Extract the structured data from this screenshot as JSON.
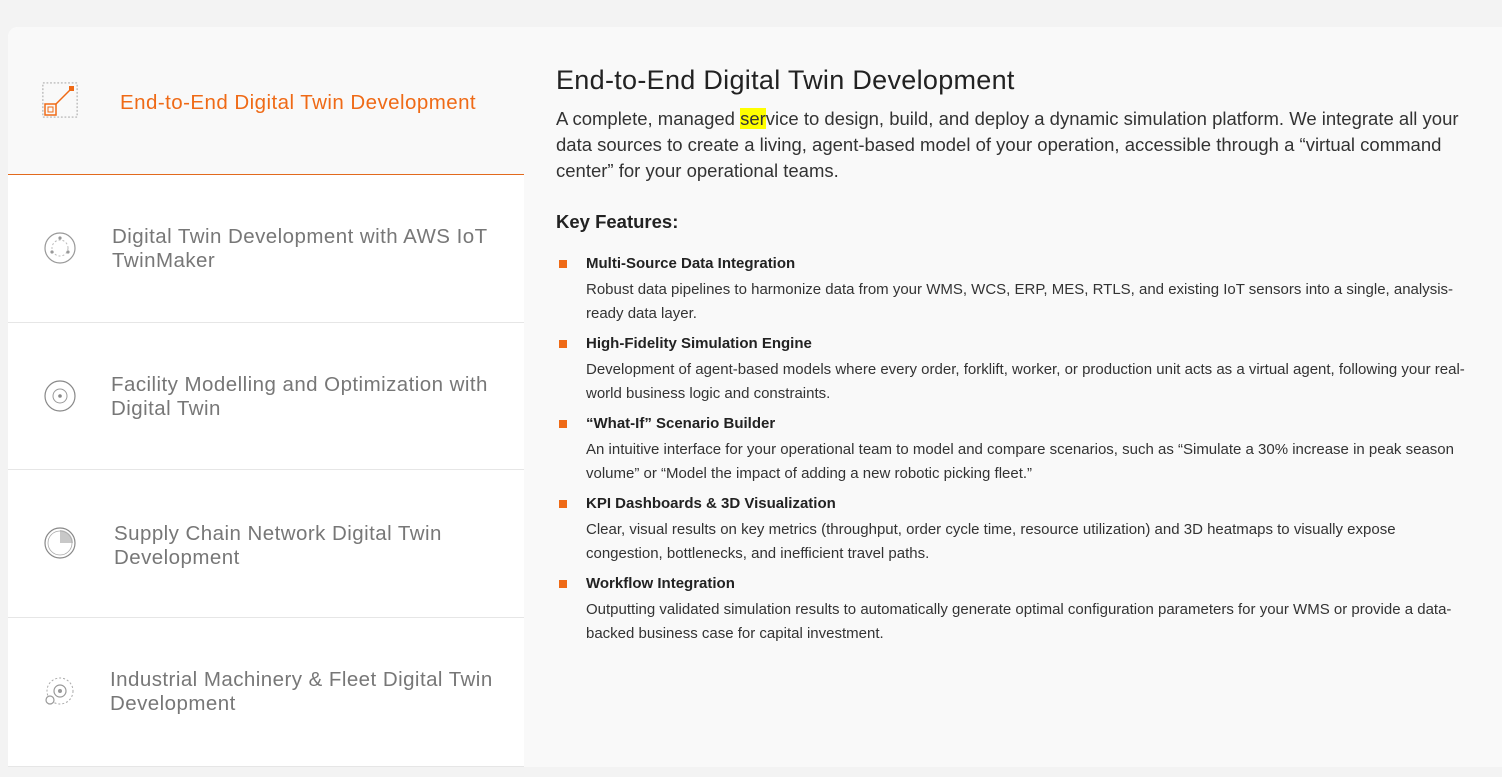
{
  "tabs": [
    {
      "label": "End-to-End Digital Twin Development",
      "icon": "diagonal-arrow-square-icon"
    },
    {
      "label": "Digital Twin Development with AWS IoT TwinMaker",
      "icon": "dotted-circle-icon"
    },
    {
      "label": "Facility Modelling and Optimization with Digital Twin",
      "icon": "target-circle-icon"
    },
    {
      "label": "Supply Chain Network Digital Twin Development",
      "icon": "quarter-pie-icon"
    },
    {
      "label": "Industrial Machinery & Fleet Digital Twin Development",
      "icon": "gear-circles-icon"
    }
  ],
  "content": {
    "title": "End-to-End Digital Twin Development",
    "description_before": "A complete, managed ",
    "description_highlight": "ser",
    "description_after": "vice to design, build, and deploy a dynamic simulation platform. We integrate all your data sources to create a living, agent-based model of your operation, accessible through a “virtual command center” for your operational teams.",
    "features_heading": "Key Features:",
    "features": [
      {
        "title": "Multi-Source Data Integration",
        "desc": "Robust data pipelines to harmonize data from your WMS, WCS, ERP, MES, RTLS, and existing IoT sensors into a single, analysis-ready data layer."
      },
      {
        "title": "High-Fidelity Simulation Engine",
        "desc": "Development of agent-based models where every order, forklift, worker, or production unit acts as a virtual agent, following your real-world business logic and constraints."
      },
      {
        "title": "“What-If” Scenario Builder",
        "desc": "An intuitive interface for your operational team to model and compare scenarios, such as “Simulate a 30% increase in peak season volume” or “Model the impact of adding a new robotic picking fleet.”"
      },
      {
        "title": "KPI Dashboards & 3D Visualization",
        "desc": "Clear, visual results on key metrics (throughput, order cycle time, resource utilization) and 3D heatmaps to visually expose congestion, bottlenecks, and inefficient travel paths."
      },
      {
        "title": "Workflow Integration",
        "desc": "Outputting validated simulation results to automatically generate optimal configuration parameters for your WMS or provide a data-backed business case for capital investment."
      }
    ]
  },
  "colors": {
    "accent": "#ef6a16",
    "highlight": "#ffff00",
    "inactive_text": "#777777"
  }
}
